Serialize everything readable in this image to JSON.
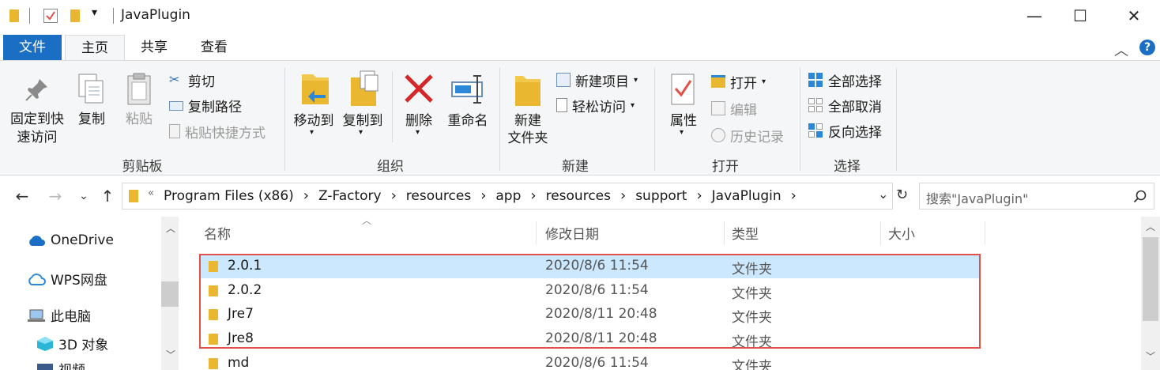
{
  "window": {
    "title": "JavaPlugin",
    "qat_dropdown": "▾",
    "minimize": "—",
    "maximize": "☐",
    "close": "✕"
  },
  "ribbon_tabs": {
    "file": "文件",
    "home": "主页",
    "share": "共享",
    "view": "查看"
  },
  "ribbon": {
    "clipboard": {
      "pin_label_1": "固定到快",
      "pin_label_2": "速访问",
      "copy": "复制",
      "paste": "粘贴",
      "cut": "剪切",
      "copy_path": "复制路径",
      "paste_shortcut": "粘贴快捷方式",
      "group": "剪贴板"
    },
    "organize": {
      "move_to": "移动到",
      "copy_to": "复制到",
      "delete": "删除",
      "rename": "重命名",
      "group": "组织"
    },
    "new": {
      "new_folder_1": "新建",
      "new_folder_2": "文件夹",
      "new_item": "新建项目",
      "easy_access": "轻松访问",
      "group": "新建"
    },
    "open": {
      "properties": "属性",
      "open": "打开",
      "edit": "编辑",
      "history": "历史记录",
      "group": "打开"
    },
    "select": {
      "select_all": "全部选择",
      "select_none": "全部取消",
      "invert": "反向选择",
      "group": "选择"
    }
  },
  "address": {
    "overflow": "«",
    "crumbs": [
      "Program Files (x86)",
      "Z-Factory",
      "resources",
      "app",
      "resources",
      "support",
      "JavaPlugin"
    ],
    "separator": "›"
  },
  "search": {
    "placeholder": "搜索\"JavaPlugin\""
  },
  "nav_pane": {
    "items": [
      "OneDrive",
      "WPS网盘",
      "此电脑",
      "3D 对象",
      "视频"
    ]
  },
  "columns": {
    "name": "名称",
    "modified": "修改日期",
    "type": "类型",
    "size": "大小"
  },
  "files": [
    {
      "name": "2.0.1",
      "modified": "2020/8/6 11:54",
      "type": "文件夹",
      "selected": true
    },
    {
      "name": "2.0.2",
      "modified": "2020/8/6 11:54",
      "type": "文件夹",
      "selected": false
    },
    {
      "name": "Jre7",
      "modified": "2020/8/11 20:48",
      "type": "文件夹",
      "selected": false
    },
    {
      "name": "Jre8",
      "modified": "2020/8/11 20:48",
      "type": "文件夹",
      "selected": false
    },
    {
      "name": "md",
      "modified": "2020/8/6 11:54",
      "type": "文件夹",
      "selected": false
    }
  ],
  "colors": {
    "accent": "#1a6fc4",
    "selection": "#cce8ff",
    "highlight_border": "#e2504a",
    "folder": "#e9b830"
  }
}
